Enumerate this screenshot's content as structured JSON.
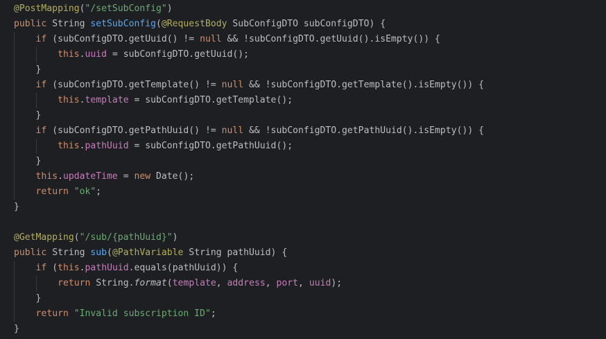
{
  "editor": {
    "lines": [
      [
        {
          "t": "@PostMapping",
          "c": "ann"
        },
        {
          "t": "(",
          "c": ""
        },
        {
          "t": "\"/setSubConfig\"",
          "c": "str"
        },
        {
          "t": ")",
          "c": ""
        }
      ],
      [
        {
          "t": "public",
          "c": "kw"
        },
        {
          "t": " String ",
          "c": ""
        },
        {
          "t": "setSubConfig",
          "c": "fn"
        },
        {
          "t": "(",
          "c": ""
        },
        {
          "t": "@RequestBody",
          "c": "ann"
        },
        {
          "t": " SubConfigDTO subConfigDTO) {",
          "c": ""
        }
      ],
      [
        {
          "t": "    ",
          "c": ""
        },
        {
          "t": "if",
          "c": "kw"
        },
        {
          "t": " (subConfigDTO.getUuid() != ",
          "c": ""
        },
        {
          "t": "null",
          "c": "kw"
        },
        {
          "t": " && !subConfigDTO.getUuid().isEmpty()) {",
          "c": ""
        }
      ],
      [
        {
          "t": "        ",
          "c": ""
        },
        {
          "t": "this",
          "c": "kw"
        },
        {
          "t": ".",
          "c": ""
        },
        {
          "t": "uuid",
          "c": "fld"
        },
        {
          "t": " = subConfigDTO.getUuid();",
          "c": ""
        }
      ],
      [
        {
          "t": "    }",
          "c": ""
        }
      ],
      [
        {
          "t": "    ",
          "c": ""
        },
        {
          "t": "if",
          "c": "kw"
        },
        {
          "t": " (subConfigDTO.getTemplate() != ",
          "c": ""
        },
        {
          "t": "null",
          "c": "kw"
        },
        {
          "t": " && !subConfigDTO.getTemplate().isEmpty()) {",
          "c": ""
        }
      ],
      [
        {
          "t": "        ",
          "c": ""
        },
        {
          "t": "this",
          "c": "kw"
        },
        {
          "t": ".",
          "c": ""
        },
        {
          "t": "template",
          "c": "fld"
        },
        {
          "t": " = subConfigDTO.getTemplate();",
          "c": ""
        }
      ],
      [
        {
          "t": "    }",
          "c": ""
        }
      ],
      [
        {
          "t": "    ",
          "c": ""
        },
        {
          "t": "if",
          "c": "kw"
        },
        {
          "t": " (subConfigDTO.getPathUuid() != ",
          "c": ""
        },
        {
          "t": "null",
          "c": "kw"
        },
        {
          "t": " && !subConfigDTO.getPathUuid().isEmpty()) {",
          "c": ""
        }
      ],
      [
        {
          "t": "        ",
          "c": ""
        },
        {
          "t": "this",
          "c": "kw"
        },
        {
          "t": ".",
          "c": ""
        },
        {
          "t": "pathUuid",
          "c": "fld"
        },
        {
          "t": " = subConfigDTO.getPathUuid();",
          "c": ""
        }
      ],
      [
        {
          "t": "    }",
          "c": ""
        }
      ],
      [
        {
          "t": "    ",
          "c": ""
        },
        {
          "t": "this",
          "c": "kw"
        },
        {
          "t": ".",
          "c": ""
        },
        {
          "t": "updateTime",
          "c": "fld"
        },
        {
          "t": " = ",
          "c": ""
        },
        {
          "t": "new",
          "c": "kw"
        },
        {
          "t": " Date();",
          "c": ""
        }
      ],
      [
        {
          "t": "    ",
          "c": ""
        },
        {
          "t": "return",
          "c": "kw"
        },
        {
          "t": " ",
          "c": ""
        },
        {
          "t": "\"ok\"",
          "c": "str"
        },
        {
          "t": ";",
          "c": ""
        }
      ],
      [
        {
          "t": "}",
          "c": ""
        }
      ],
      [],
      [
        {
          "t": "@GetMapping",
          "c": "ann"
        },
        {
          "t": "(",
          "c": ""
        },
        {
          "t": "\"/sub/{pathUuid}\"",
          "c": "str"
        },
        {
          "t": ")",
          "c": ""
        }
      ],
      [
        {
          "t": "public",
          "c": "kw"
        },
        {
          "t": " String ",
          "c": ""
        },
        {
          "t": "sub",
          "c": "fn"
        },
        {
          "t": "(",
          "c": ""
        },
        {
          "t": "@PathVariable",
          "c": "ann"
        },
        {
          "t": " String pathUuid) {",
          "c": ""
        }
      ],
      [
        {
          "t": "    ",
          "c": ""
        },
        {
          "t": "if",
          "c": "kw"
        },
        {
          "t": " (",
          "c": ""
        },
        {
          "t": "this",
          "c": "kw"
        },
        {
          "t": ".",
          "c": ""
        },
        {
          "t": "pathUuid",
          "c": "fld"
        },
        {
          "t": ".equals(pathUuid)) {",
          "c": ""
        }
      ],
      [
        {
          "t": "        ",
          "c": ""
        },
        {
          "t": "return",
          "c": "kw"
        },
        {
          "t": " String.",
          "c": ""
        },
        {
          "t": "format",
          "c": "it"
        },
        {
          "t": "(",
          "c": ""
        },
        {
          "t": "template",
          "c": "fld"
        },
        {
          "t": ", ",
          "c": ""
        },
        {
          "t": "address",
          "c": "fld"
        },
        {
          "t": ", ",
          "c": ""
        },
        {
          "t": "port",
          "c": "fld"
        },
        {
          "t": ", ",
          "c": ""
        },
        {
          "t": "uuid",
          "c": "fld"
        },
        {
          "t": ");",
          "c": ""
        }
      ],
      [
        {
          "t": "    }",
          "c": ""
        }
      ],
      [
        {
          "t": "    ",
          "c": ""
        },
        {
          "t": "return",
          "c": "kw"
        },
        {
          "t": " ",
          "c": ""
        },
        {
          "t": "\"Invalid subscription ID\"",
          "c": "str"
        },
        {
          "t": ";",
          "c": ""
        }
      ],
      [
        {
          "t": "}",
          "c": ""
        }
      ]
    ]
  },
  "colors": {
    "background": "#1e1f22",
    "default_text": "#bcbec4",
    "keyword": "#cf8e6d",
    "annotation": "#b3ae60",
    "string": "#6aab73",
    "method_declaration": "#56a8f5",
    "field": "#c77dbb",
    "indent_guide": "#393b40"
  }
}
